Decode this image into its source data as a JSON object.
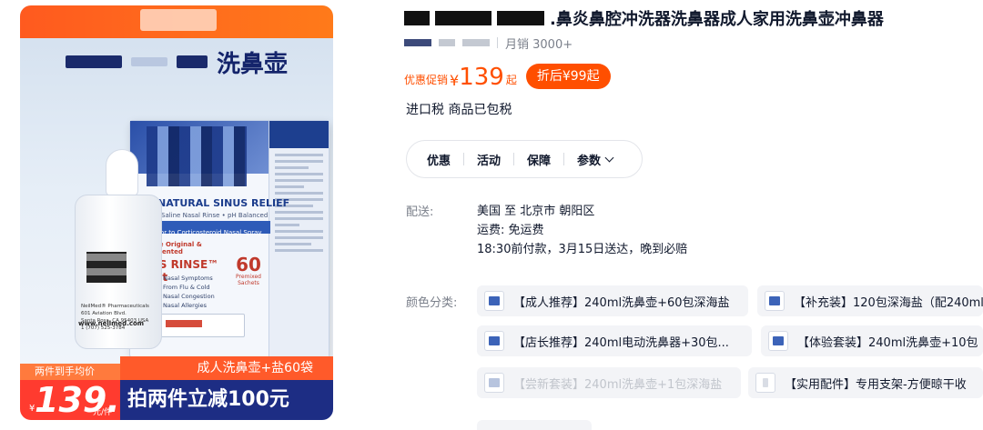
{
  "hero": {
    "title_suffix": "洗鼻壶",
    "box": {
      "headline": "NATURAL SINUS RELIEF",
      "subline": "Saline Nasal Rinse • pH Balanced",
      "band": "Prior to Corticosteroid Nasal Spray",
      "kit_line1": "The Original & Patented",
      "kit_line2": "US RINSE™ Kit",
      "count": "60",
      "count_label": "Premixed Sachets",
      "symptoms": [
        "Nasal Symptoms",
        "From Flu & Cold",
        "Nasal Congestion",
        "Nasal Allergies"
      ]
    },
    "bottle": {
      "company": "NeilMed® Pharmaceuticals",
      "address": [
        "601 Aviation Blvd.",
        "Santa Rosa, CA 95403 USA",
        "1 (707) 525-3784"
      ],
      "url": "www.neilmed.com"
    },
    "banner": {
      "tag": "两件到手均价",
      "right_text": "成人洗鼻壶+盐60袋",
      "currency": "¥",
      "price": "139.",
      "unit": "元/件",
      "promo": "拍两件立减100元"
    }
  },
  "product": {
    "title": ".鼻炎鼻腔冲洗器洗鼻器成人家用洗鼻壶冲鼻器",
    "sales": "月销 3000+",
    "price_label": "优惠促销",
    "currency": "¥",
    "price": "139",
    "price_suffix": "起",
    "discount_pill": "折后¥99起",
    "tax_note": "进口税 商品已包税"
  },
  "tabs": [
    {
      "label": "优惠"
    },
    {
      "label": "活动"
    },
    {
      "label": "保障"
    },
    {
      "label": "参数"
    }
  ],
  "shipping": {
    "label": "配送:",
    "route": "美国 至 北京市 朝阳区",
    "fee": "运费: 免运费",
    "eta": "18:30前付款，3月15日送达，晚到必赔"
  },
  "colors": {
    "label": "颜色分类:",
    "options": [
      {
        "label": "【成人推荐】240ml洗鼻壶+60包深海盐",
        "disabled": false
      },
      {
        "label": "【补充装】120包深海盐（配240ml",
        "disabled": false
      },
      {
        "label": "【店长推荐】240ml电动洗鼻器+30包...",
        "disabled": false
      },
      {
        "label": "【体验套装】240ml洗鼻壶+10包",
        "disabled": false
      },
      {
        "label": "【尝新套装】240ml洗鼻壶+1包深海盐",
        "disabled": true
      },
      {
        "label": "【实用配件】专用支架-方便晾干收",
        "disabled": false
      }
    ]
  },
  "accent_color": "#ff4f00"
}
